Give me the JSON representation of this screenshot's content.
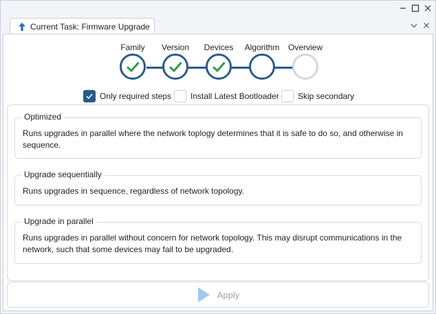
{
  "window": {
    "controls": [
      "minimize-icon",
      "maximize-icon",
      "close-icon"
    ]
  },
  "tab": {
    "icon": "arrow-up-icon",
    "title": "Current Task: Firmware Upgrade",
    "strip_buttons": [
      "chevron-down-icon",
      "close-icon"
    ]
  },
  "stepper": {
    "steps": [
      {
        "label": "Family",
        "state": "done"
      },
      {
        "label": "Version",
        "state": "done"
      },
      {
        "label": "Devices",
        "state": "done"
      },
      {
        "label": "Algorithm",
        "state": "current"
      },
      {
        "label": "Overview",
        "state": "pending"
      }
    ]
  },
  "options": [
    {
      "label": "Only required steps",
      "checked": true
    },
    {
      "label": "Install Latest Bootloader",
      "checked": false
    },
    {
      "label": "Skip secondary",
      "checked": false
    }
  ],
  "algorithms": [
    {
      "title": "Optimized",
      "description": "Runs upgrades in parallel where the network toplogy determines that it is safe to do so, and otherwise in sequence."
    },
    {
      "title": "Upgrade sequentially",
      "description": "Runs upgrades in sequence, regardless of network topology."
    },
    {
      "title": "Upgrade in parallel",
      "description": "Runs upgrades in parallel without concern for network topology. This may disrupt communications in the network, such that some devices may fail to be upgraded."
    }
  ],
  "apply": {
    "label": "Apply",
    "icon": "play-icon",
    "enabled": false
  },
  "colors": {
    "accent": "#2a5a8a",
    "check": "#2e9b4e",
    "tab_icon": "#1e6fc0",
    "disabled": "#9aa3ad",
    "pending": "#d6d6d6"
  }
}
